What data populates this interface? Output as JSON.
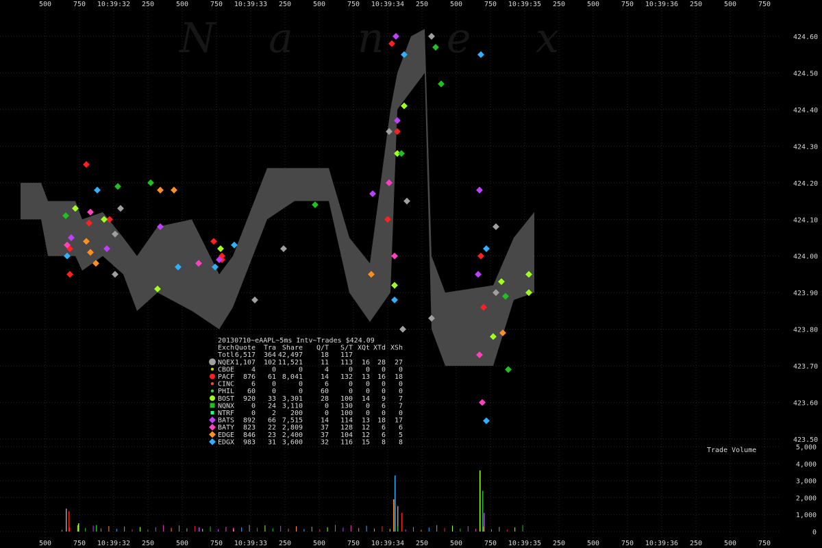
{
  "watermark": "Nanex",
  "table": {
    "title": "20130710~eAAPL~5ms Intv~Trades $424.09",
    "headers": [
      "Exch",
      "Quote",
      "Tra",
      "Share",
      "Q/T",
      "S/T",
      "XQt",
      "XTd",
      "XSh"
    ],
    "total_row": [
      "Totl",
      "6,517",
      "364",
      "42,497",
      "18",
      "117",
      "",
      "",
      ""
    ],
    "rows": [
      {
        "exch": "NQEX",
        "marker": "circle-large",
        "color": "#a0a0a0",
        "cells": [
          "1,107",
          "102",
          "11,521",
          "11",
          "113",
          "16",
          "28",
          "27"
        ]
      },
      {
        "exch": "CBOE",
        "marker": "dot",
        "color": "#c8c800",
        "cells": [
          "4",
          "0",
          "0",
          "4",
          "0",
          "0",
          "0",
          "0"
        ]
      },
      {
        "exch": "PACF",
        "marker": "circle",
        "color": "#ff2020",
        "cells": [
          "876",
          "61",
          "8,041",
          "14",
          "132",
          "13",
          "16",
          "18"
        ]
      },
      {
        "exch": "CINC",
        "marker": "dot",
        "color": "#ff4040",
        "cells": [
          "6",
          "0",
          "0",
          "6",
          "0",
          "0",
          "0",
          "0"
        ]
      },
      {
        "exch": "PHIL",
        "marker": "dot",
        "color": "#40d040",
        "cells": [
          "60",
          "0",
          "0",
          "60",
          "0",
          "0",
          "0",
          "0"
        ]
      },
      {
        "exch": "BOST",
        "marker": "circle",
        "color": "#a0ff20",
        "cells": [
          "920",
          "33",
          "3,301",
          "28",
          "100",
          "14",
          "9",
          "7"
        ]
      },
      {
        "exch": "NQNX",
        "marker": "square",
        "color": "#20c020",
        "cells": [
          "0",
          "24",
          "3,110",
          "0",
          "130",
          "0",
          "6",
          "7"
        ]
      },
      {
        "exch": "NTRF",
        "marker": "square-small",
        "color": "#20ff80",
        "cells": [
          "0",
          "2",
          "200",
          "0",
          "100",
          "0",
          "0",
          "0"
        ]
      },
      {
        "exch": "BATS",
        "marker": "diamond",
        "color": "#c040ff",
        "cells": [
          "892",
          "66",
          "7,515",
          "14",
          "114",
          "13",
          "18",
          "17"
        ]
      },
      {
        "exch": "BATY",
        "marker": "diamond",
        "color": "#ff40c0",
        "cells": [
          "823",
          "22",
          "2,809",
          "37",
          "128",
          "12",
          "6",
          "6"
        ]
      },
      {
        "exch": "EDGE",
        "marker": "diamond",
        "color": "#ff9020",
        "cells": [
          "846",
          "23",
          "2,400",
          "37",
          "104",
          "12",
          "6",
          "5"
        ]
      },
      {
        "exch": "EDGX",
        "marker": "diamond",
        "color": "#30b0ff",
        "cells": [
          "983",
          "31",
          "3,600",
          "32",
          "116",
          "15",
          "8",
          "8"
        ]
      }
    ]
  },
  "volume_panel": {
    "title": "Trade Volume"
  },
  "chart_data": {
    "type": "scatter",
    "title": "20130710~eAAPL~5ms Intv~Trades $424.09",
    "y_axis": {
      "ticks": [
        "424.60",
        "424.50",
        "424.40",
        "424.30",
        "424.20",
        "424.10",
        "424.00",
        "423.90",
        "423.80",
        "423.70",
        "423.60",
        "423.50"
      ],
      "ylim": [
        423.5,
        424.6
      ]
    },
    "volume_axis": {
      "ticks": [
        "5,000",
        "4,000",
        "3,000",
        "2,000",
        "1,000",
        "0"
      ],
      "ylim": [
        0,
        5000
      ]
    },
    "x_axis": {
      "ticks": [
        "500",
        "750",
        "10:39:32",
        "250",
        "500",
        "750",
        "10:39:33",
        "250",
        "500",
        "750",
        "10:39:34",
        "250",
        "500",
        "750",
        "10:39:35",
        "250",
        "500",
        "750",
        "10:39:36",
        "250",
        "500",
        "750"
      ]
    },
    "nbbo_band": [
      {
        "t": 0.0,
        "bid": 424.1,
        "ask": 424.2
      },
      {
        "t": 0.15,
        "bid": 424.1,
        "ask": 424.2
      },
      {
        "t": 0.2,
        "bid": 424.0,
        "ask": 424.15
      },
      {
        "t": 0.4,
        "bid": 424.0,
        "ask": 424.15
      },
      {
        "t": 0.45,
        "bid": 423.96,
        "ask": 424.1
      },
      {
        "t": 0.6,
        "bid": 424.0,
        "ask": 424.12
      },
      {
        "t": 0.75,
        "bid": 423.95,
        "ask": 424.05
      },
      {
        "t": 0.85,
        "bid": 423.85,
        "ask": 424.0
      },
      {
        "t": 1.0,
        "bid": 423.9,
        "ask": 424.08
      },
      {
        "t": 1.25,
        "bid": 423.85,
        "ask": 424.1
      },
      {
        "t": 1.45,
        "bid": 423.8,
        "ask": 423.95
      },
      {
        "t": 1.55,
        "bid": 423.86,
        "ask": 424.0
      },
      {
        "t": 1.8,
        "bid": 424.1,
        "ask": 424.24
      },
      {
        "t": 2.0,
        "bid": 424.15,
        "ask": 424.24
      },
      {
        "t": 2.25,
        "bid": 424.15,
        "ask": 424.24
      },
      {
        "t": 2.4,
        "bid": 423.9,
        "ask": 424.05
      },
      {
        "t": 2.55,
        "bid": 423.82,
        "ask": 423.98
      },
      {
        "t": 2.7,
        "bid": 423.9,
        "ask": 424.4
      },
      {
        "t": 2.75,
        "bid": 424.4,
        "ask": 424.5
      },
      {
        "t": 2.85,
        "bid": 424.45,
        "ask": 424.6
      },
      {
        "t": 2.95,
        "bid": 424.5,
        "ask": 424.62
      },
      {
        "t": 3.0,
        "bid": 423.8,
        "ask": 424.0
      },
      {
        "t": 3.1,
        "bid": 423.7,
        "ask": 423.9
      },
      {
        "t": 3.45,
        "bid": 423.7,
        "ask": 423.92
      },
      {
        "t": 3.6,
        "bid": 423.88,
        "ask": 424.05
      },
      {
        "t": 3.75,
        "bid": 423.9,
        "ask": 424.12
      }
    ],
    "series": [
      {
        "name": "NQEX",
        "color": "#a0a0a0",
        "points": [
          [
            0.69,
            424.06
          ],
          [
            0.69,
            423.95
          ],
          [
            0.73,
            424.13
          ],
          [
            1.71,
            423.88
          ],
          [
            1.92,
            424.02
          ],
          [
            2.69,
            424.34
          ],
          [
            2.79,
            423.8
          ],
          [
            2.82,
            424.15
          ],
          [
            3.0,
            423.83
          ],
          [
            3.0,
            424.6
          ],
          [
            3.47,
            424.08
          ],
          [
            3.47,
            423.9
          ]
        ]
      },
      {
        "name": "PACF",
        "color": "#ff2020",
        "points": [
          [
            0.36,
            424.02
          ],
          [
            0.36,
            423.95
          ],
          [
            0.48,
            424.25
          ],
          [
            0.5,
            424.09
          ],
          [
            0.65,
            424.1
          ],
          [
            1.41,
            424.04
          ],
          [
            1.47,
            424.0
          ],
          [
            1.47,
            423.99
          ],
          [
            2.68,
            424.1
          ],
          [
            2.71,
            424.58
          ],
          [
            2.75,
            424.34
          ],
          [
            3.36,
            424.0
          ],
          [
            3.38,
            423.86
          ]
        ]
      },
      {
        "name": "BOST",
        "color": "#a0ff20",
        "points": [
          [
            0.4,
            424.13
          ],
          [
            0.61,
            424.1
          ],
          [
            1.0,
            423.91
          ],
          [
            1.46,
            424.02
          ],
          [
            2.73,
            423.92
          ],
          [
            2.75,
            424.28
          ],
          [
            2.8,
            424.41
          ],
          [
            3.45,
            423.78
          ],
          [
            3.51,
            423.93
          ],
          [
            3.71,
            423.95
          ],
          [
            3.71,
            423.9
          ]
        ]
      },
      {
        "name": "NQNX",
        "color": "#20c020",
        "points": [
          [
            0.33,
            424.11
          ],
          [
            0.71,
            424.19
          ],
          [
            0.95,
            424.2
          ],
          [
            2.15,
            424.14
          ],
          [
            2.78,
            424.28
          ],
          [
            3.03,
            424.57
          ],
          [
            3.07,
            424.47
          ],
          [
            3.54,
            423.89
          ],
          [
            3.56,
            423.69
          ]
        ]
      },
      {
        "name": "BATS",
        "color": "#c040ff",
        "points": [
          [
            0.37,
            424.05
          ],
          [
            0.63,
            424.02
          ],
          [
            1.02,
            424.08
          ],
          [
            1.45,
            423.99
          ],
          [
            2.57,
            424.17
          ],
          [
            2.74,
            424.6
          ],
          [
            2.75,
            424.37
          ],
          [
            3.34,
            423.95
          ],
          [
            3.35,
            424.18
          ]
        ]
      },
      {
        "name": "BATY",
        "color": "#ff40c0",
        "points": [
          [
            0.34,
            424.03
          ],
          [
            0.51,
            424.12
          ],
          [
            1.3,
            423.98
          ],
          [
            2.69,
            424.2
          ],
          [
            2.73,
            424.0
          ],
          [
            3.35,
            423.73
          ],
          [
            3.37,
            423.6
          ]
        ]
      },
      {
        "name": "EDGE",
        "color": "#ff9020",
        "points": [
          [
            0.48,
            424.04
          ],
          [
            0.51,
            424.01
          ],
          [
            0.55,
            423.98
          ],
          [
            1.02,
            424.18
          ],
          [
            1.12,
            424.18
          ],
          [
            2.56,
            423.95
          ],
          [
            3.52,
            423.79
          ]
        ]
      },
      {
        "name": "EDGX",
        "color": "#30b0ff",
        "points": [
          [
            0.34,
            424.0
          ],
          [
            0.56,
            424.18
          ],
          [
            1.15,
            423.97
          ],
          [
            1.42,
            423.97
          ],
          [
            1.56,
            424.03
          ],
          [
            2.73,
            423.88
          ],
          [
            2.8,
            424.55
          ],
          [
            3.36,
            424.55
          ],
          [
            3.4,
            424.02
          ],
          [
            3.4,
            423.55
          ]
        ]
      }
    ],
    "volume": {
      "color_note": "stacked bars by exchange color",
      "peaks": [
        [
          0.33,
          1350
        ],
        [
          0.35,
          1200
        ],
        [
          0.42,
          480
        ],
        [
          0.55,
          380
        ],
        [
          1.3,
          250
        ],
        [
          1.55,
          220
        ],
        [
          2.72,
          1900
        ],
        [
          2.73,
          3300
        ],
        [
          2.75,
          1500
        ],
        [
          2.78,
          1100
        ],
        [
          3.35,
          3600
        ],
        [
          3.37,
          2400
        ],
        [
          3.38,
          1100
        ]
      ]
    }
  }
}
